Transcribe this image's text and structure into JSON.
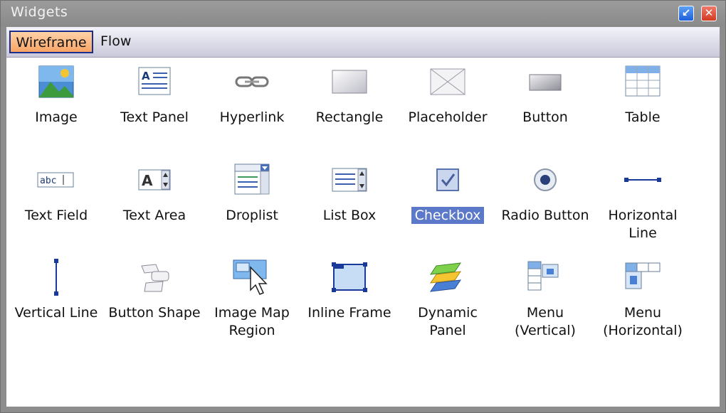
{
  "window": {
    "title": "Widgets",
    "restore_icon": "restore-icon",
    "close_icon": "close-icon"
  },
  "tabs": [
    {
      "label": "Wireframe",
      "active": true
    },
    {
      "label": "Flow",
      "active": false
    }
  ],
  "widgets": [
    {
      "label": "Image",
      "icon": "image-icon"
    },
    {
      "label": "Text Panel",
      "icon": "text-panel-icon"
    },
    {
      "label": "Hyperlink",
      "icon": "hyperlink-icon"
    },
    {
      "label": "Rectangle",
      "icon": "rectangle-icon"
    },
    {
      "label": "Placeholder",
      "icon": "placeholder-icon"
    },
    {
      "label": "Button",
      "icon": "button-icon"
    },
    {
      "label": "Table",
      "icon": "table-icon"
    },
    {
      "label": "Text Field",
      "icon": "text-field-icon"
    },
    {
      "label": "Text Area",
      "icon": "text-area-icon"
    },
    {
      "label": "Droplist",
      "icon": "droplist-icon"
    },
    {
      "label": "List Box",
      "icon": "list-box-icon"
    },
    {
      "label": "Checkbox",
      "icon": "checkbox-icon",
      "selected": true
    },
    {
      "label": "Radio Button",
      "icon": "radio-button-icon"
    },
    {
      "label": "Horizontal\nLine",
      "icon": "horizontal-line-icon"
    },
    {
      "label": "Vertical Line",
      "icon": "vertical-line-icon"
    },
    {
      "label": "Button Shape",
      "icon": "button-shape-icon"
    },
    {
      "label": "Image Map\nRegion",
      "icon": "image-map-region-icon"
    },
    {
      "label": "Inline Frame",
      "icon": "inline-frame-icon"
    },
    {
      "label": "Dynamic\nPanel",
      "icon": "dynamic-panel-icon"
    },
    {
      "label": "Menu\n(Vertical)",
      "icon": "menu-vertical-icon"
    },
    {
      "label": "Menu\n(Horizontal)",
      "icon": "menu-horizontal-icon"
    }
  ],
  "colors": {
    "tab_active": "#f7a565",
    "selection": "#5b79c8",
    "window_frame": "#8d8d8d"
  }
}
